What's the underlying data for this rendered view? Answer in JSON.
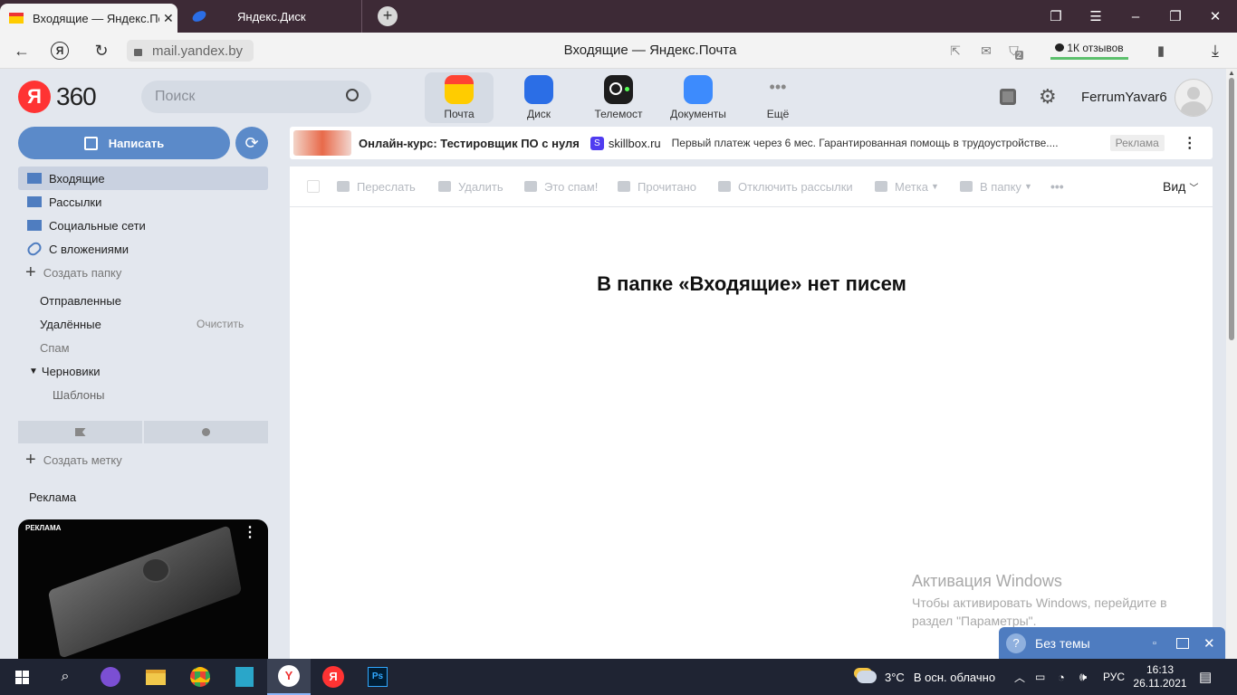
{
  "browser": {
    "tabs": [
      {
        "title": "Входящие — Яндекс.Почта",
        "display": "Входящие — Яндекс.По"
      },
      {
        "title": "Яндекс.Диск"
      }
    ],
    "url": "mail.yandex.by",
    "page_title": "Входящие — Яндекс.Почта",
    "reviews": "1К отзывов",
    "ext_badge": "2"
  },
  "header": {
    "logo_ya": "Я",
    "logo_360": "360",
    "search_placeholder": "Поиск",
    "services": [
      {
        "label": "Почта",
        "icon": "mail-icon",
        "color": "#ffcc00"
      },
      {
        "label": "Диск",
        "icon": "disk-icon",
        "color": "#2b6ee6"
      },
      {
        "label": "Телемост",
        "icon": "telemost-icon",
        "color": "#1d1d1d"
      },
      {
        "label": "Документы",
        "icon": "documents-icon",
        "color": "#3d8bfd"
      },
      {
        "label": "Ещё",
        "icon": "more-icon"
      }
    ],
    "username": "FerrumYavar6"
  },
  "sidebar": {
    "compose": "Написать",
    "folders": [
      {
        "label": "Входящие",
        "icon": "inbox-icon"
      },
      {
        "label": "Рассылки",
        "icon": "newsletters-icon"
      },
      {
        "label": "Социальные сети",
        "icon": "social-icon"
      },
      {
        "label": "С вложениями",
        "icon": "attachment-icon"
      }
    ],
    "create_folder": "Создать папку",
    "sent": "Отправленные",
    "deleted": "Удалённые",
    "clear": "Очистить",
    "spam": "Спам",
    "drafts": "Черновики",
    "templates": "Шаблоны",
    "create_label": "Создать метку",
    "ad_heading": "Реклама",
    "ad_badge": "РЕКЛАМА"
  },
  "ad_banner": {
    "title": "Онлайн-курс: Тестировщик ПО с нуля",
    "brand": "skillbox.ru",
    "brand_letter": "S",
    "text": "Первый платеж через 6 мес. Гарантированная помощь в трудоустройстве....",
    "badge": "Реклама"
  },
  "toolbar": {
    "forward": "Переслать",
    "delete": "Удалить",
    "spam": "Это спам!",
    "read": "Прочитано",
    "unsubscribe": "Отключить рассылки",
    "label": "Метка",
    "to_folder": "В папку",
    "view": "Вид"
  },
  "main": {
    "empty_message": "В папке «Входящие» нет писем"
  },
  "watermark": {
    "title": "Активация Windows",
    "line1": "Чтобы активировать Windows, перейдите в",
    "line2": "раздел \"Параметры\"."
  },
  "theme_popup": {
    "label": "Без темы",
    "icon": "?"
  },
  "taskbar": {
    "weather_temp": "3°C",
    "weather_text": "В осн. облачно",
    "lang": "РУС",
    "time": "16:13",
    "date": "26.11.2021"
  },
  "colors": {
    "compose": "#5b8ac9",
    "tabstrip": "#3d2a36",
    "taskbar": "#1f2433",
    "selected_folder": "#c9d1e0"
  }
}
